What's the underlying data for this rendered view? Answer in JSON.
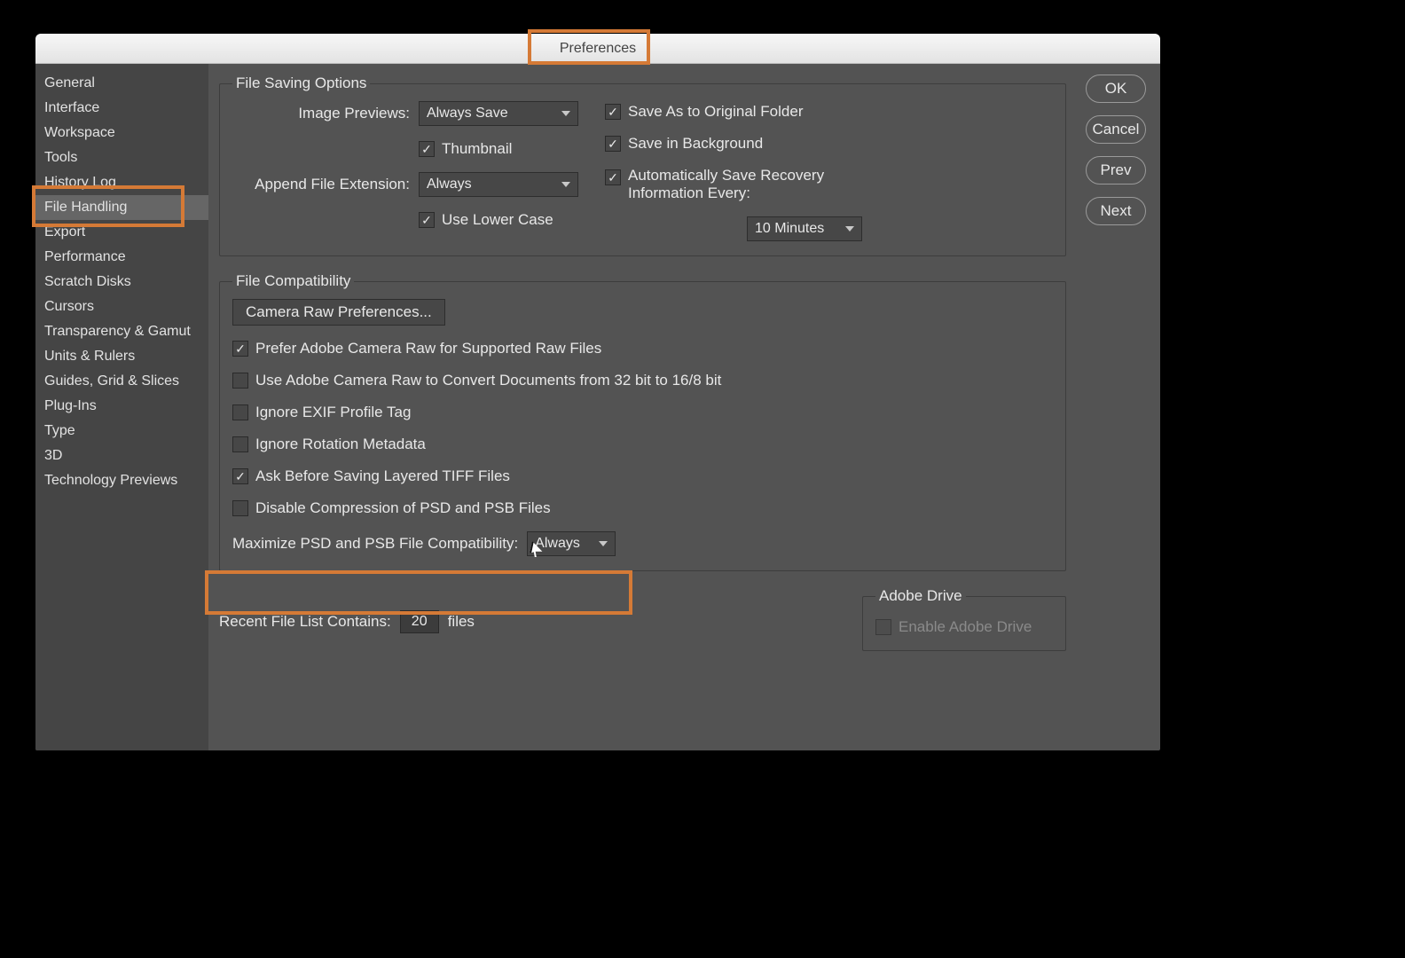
{
  "window_title": "Preferences",
  "sidebar": {
    "items": [
      "General",
      "Interface",
      "Workspace",
      "Tools",
      "History Log",
      "File Handling",
      "Export",
      "Performance",
      "Scratch Disks",
      "Cursors",
      "Transparency & Gamut",
      "Units & Rulers",
      "Guides, Grid & Slices",
      "Plug-Ins",
      "Type",
      "3D",
      "Technology Previews"
    ],
    "selected_index": 5
  },
  "buttons": {
    "ok": "OK",
    "cancel": "Cancel",
    "prev": "Prev",
    "next": "Next"
  },
  "file_saving": {
    "legend": "File Saving Options",
    "image_previews_label": "Image Previews:",
    "image_previews_value": "Always Save",
    "thumbnail_label": "Thumbnail",
    "append_ext_label": "Append File Extension:",
    "append_ext_value": "Always",
    "use_lower_case_label": "Use Lower Case",
    "save_as_original_label": "Save As to Original Folder",
    "save_bg_label": "Save in Background",
    "auto_save_label": "Automatically Save Recovery Information Every:",
    "auto_save_interval": "10 Minutes"
  },
  "file_compat": {
    "legend": "File Compatibility",
    "camera_raw_btn": "Camera Raw Preferences...",
    "prefer_acr_label": "Prefer Adobe Camera Raw for Supported Raw Files",
    "use_acr_32_label": "Use Adobe Camera Raw to Convert Documents from 32 bit to 16/8 bit",
    "ignore_exif_label": "Ignore EXIF Profile Tag",
    "ignore_rotation_label": "Ignore Rotation Metadata",
    "ask_tiff_label": "Ask Before Saving Layered TIFF Files",
    "disable_compress_label": "Disable Compression of PSD and PSB Files",
    "maximize_label": "Maximize PSD and PSB File Compatibility:",
    "maximize_value": "Always"
  },
  "recent": {
    "label": "Recent File List Contains:",
    "value": "20",
    "suffix": "files"
  },
  "adobe_drive": {
    "legend": "Adobe Drive",
    "enable_label": "Enable Adobe Drive"
  }
}
